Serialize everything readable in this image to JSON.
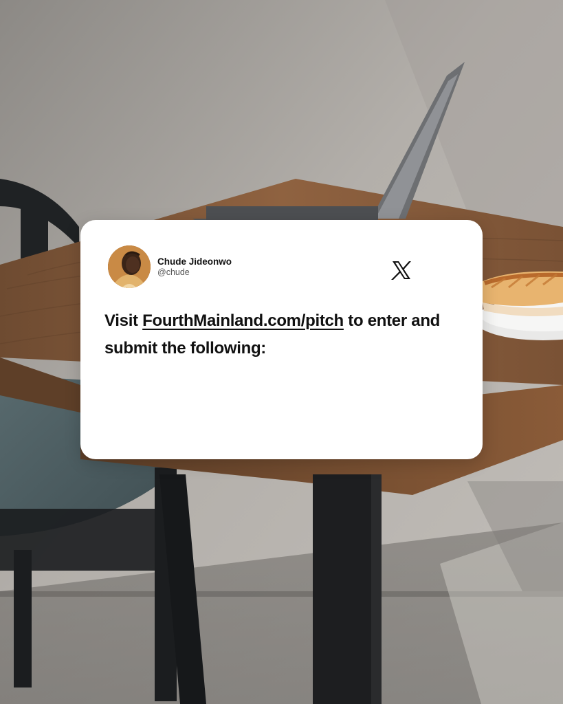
{
  "post": {
    "author_name": "Chude Jideonwo",
    "author_handle": "@chude",
    "platform_icon": "x-logo-icon",
    "text_before": "Visit ",
    "link_text": "FourthMainland.com/pitch",
    "text_after": " to enter and submit the following:"
  },
  "colors": {
    "card_background": "#ffffff",
    "text": "#111111",
    "table_wood": "#8a5e3b",
    "wall": "#a7a39e"
  }
}
